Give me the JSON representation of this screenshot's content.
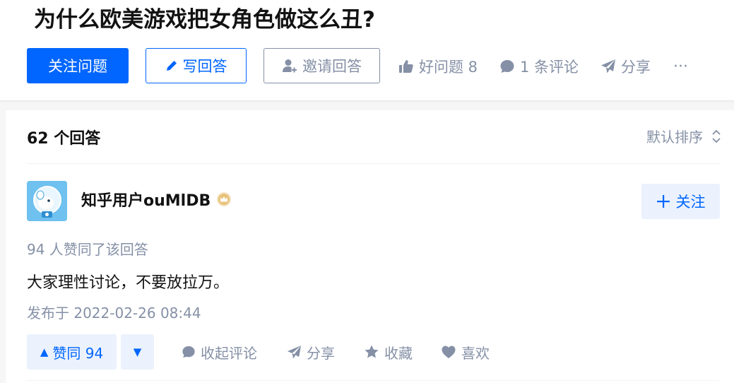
{
  "question": {
    "title": "为什么欧美游戏把女角色做这么丑?",
    "follow_label": "关注问题",
    "write_label": "写回答",
    "invite_label": "邀请回答",
    "good_question_label": "好问题 8",
    "comments_label": "1 条评论",
    "share_label": "分享",
    "more_label": "···"
  },
  "answers": {
    "count_label": "62 个回答",
    "sort_label": "默认排序"
  },
  "answer": {
    "author_name": "知乎用户ouMlDB",
    "follow_label": "关注",
    "vote_info": "94 人赞同了该回答",
    "content": "大家理性讨论，不要放拉万。",
    "time": "发布于 2022-02-26 08:44",
    "upvote_label": "赞同 94",
    "upvote_arrow": "▲",
    "downvote_arrow": "▼",
    "collapse_comments_label": "收起评论",
    "share_label": "分享",
    "collect_label": "收藏",
    "like_label": "喜欢"
  },
  "colors": {
    "brand_blue": "#0066ff",
    "muted_gray": "#8590a6",
    "light_blue_bg": "#ebf2fd"
  },
  "icons": [
    "pencil-icon",
    "invite-user-icon",
    "thumbs-up-icon",
    "comment-bubble-icon",
    "paper-plane-icon",
    "more-dots-icon",
    "sort-arrows-icon",
    "crown-badge-icon",
    "plus-icon",
    "star-icon",
    "heart-icon"
  ]
}
